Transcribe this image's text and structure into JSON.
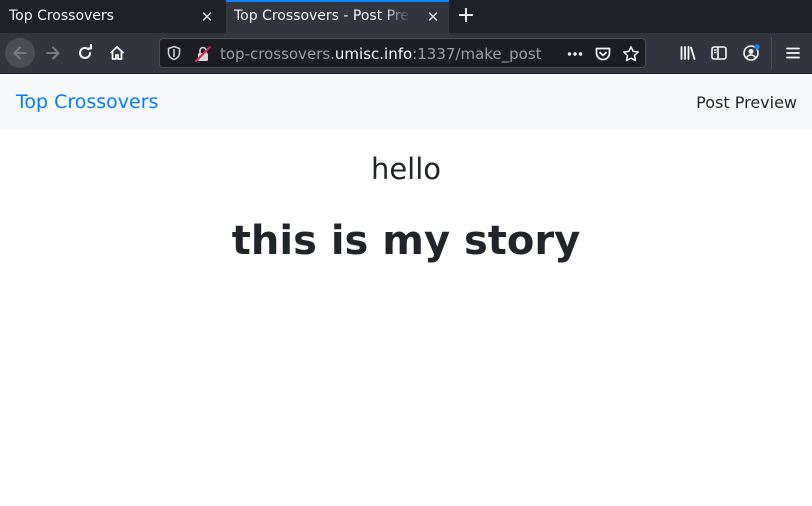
{
  "browser": {
    "tabs": [
      {
        "title": "Top Crossovers",
        "active": false,
        "close_icon": "close-icon"
      },
      {
        "title": "Top Crossovers - Post Preview",
        "active": true,
        "close_icon": "close-icon"
      }
    ],
    "new_tab_icon": "plus-icon",
    "url": {
      "prefix": "top-crossovers.",
      "domain": "umisc.info",
      "suffix": ":1337/make_post"
    },
    "icons": {
      "back": "arrow-left-icon",
      "forward": "arrow-right-icon",
      "reload": "reload-icon",
      "home": "home-icon",
      "shield": "shield-icon",
      "insecure": "insecure-lock-icon",
      "page_actions": "more-icon",
      "pocket": "pocket-icon",
      "bookmark": "star-icon",
      "library": "library-icon",
      "sidebar": "sidebar-icon",
      "account": "account-icon",
      "menu": "hamburger-menu-icon"
    },
    "colors": {
      "tabstrip": "#1f2129",
      "active_tab": "#32353f",
      "accent": "#0a84ff"
    }
  },
  "page": {
    "brand": "Top Crossovers",
    "nav_right": "Post Preview",
    "post": {
      "title": "hello",
      "body": "this is my story"
    },
    "colors": {
      "brand": "#007bff",
      "text": "#212529",
      "header_bg": "#f8f9fa"
    }
  }
}
